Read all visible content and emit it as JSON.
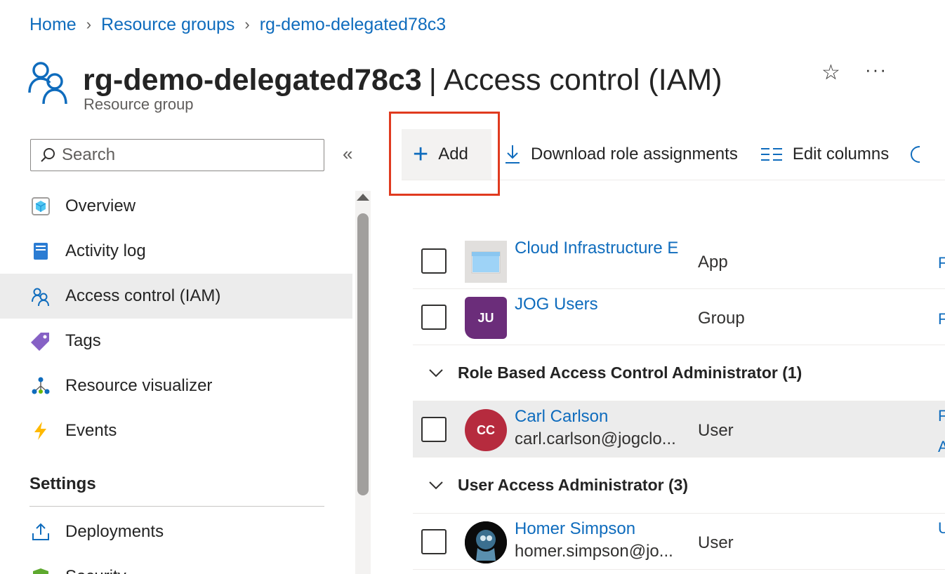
{
  "breadcrumb": {
    "items": [
      "Home",
      "Resource groups",
      "rg-demo-delegated78c3"
    ]
  },
  "header": {
    "title_bold": "rg-demo-delegated78c3",
    "title_rest": "Access control (IAM)",
    "subtitle": "Resource group"
  },
  "sidebar": {
    "search_placeholder": "Search",
    "items": [
      {
        "label": "Overview",
        "icon": "cube-icon"
      },
      {
        "label": "Activity log",
        "icon": "log-icon"
      },
      {
        "label": "Access control (IAM)",
        "icon": "people-icon",
        "selected": true
      },
      {
        "label": "Tags",
        "icon": "tag-icon"
      },
      {
        "label": "Resource visualizer",
        "icon": "tree-icon"
      },
      {
        "label": "Events",
        "icon": "lightning-icon"
      }
    ],
    "settings_heading": "Settings",
    "settings_items": [
      {
        "label": "Deployments",
        "icon": "upload-icon"
      },
      {
        "label": "Security",
        "icon": "shield-icon"
      }
    ]
  },
  "toolbar": {
    "add_label": "Add",
    "download_label": "Download role assignments",
    "edit_columns_label": "Edit columns"
  },
  "table": {
    "rows_top": [
      {
        "name": "Cloud Infrastructure E",
        "type": "App",
        "avatar": "app",
        "trail": "F"
      },
      {
        "name": "JOG Users",
        "type": "Group",
        "avatar": "JU",
        "trail": "F"
      }
    ],
    "groups": [
      {
        "title": "Role Based Access Control Administrator (1)",
        "rows": [
          {
            "name": "Carl Carlson",
            "email": "carl.carlson@jogclo...",
            "type": "User",
            "avatar": "CC",
            "trail": "F",
            "trail2": "A"
          }
        ]
      },
      {
        "title": "User Access Administrator (3)",
        "rows": [
          {
            "name": "Homer Simpson",
            "email": "homer.simpson@jo...",
            "type": "User",
            "avatar": "photo",
            "trail": "U"
          }
        ]
      }
    ]
  },
  "colors": {
    "accent": "#0f6cbd",
    "highlight": "#e03a1f",
    "group_avatar": "#6b2d7a",
    "user_avatar": "#b62b3e"
  }
}
